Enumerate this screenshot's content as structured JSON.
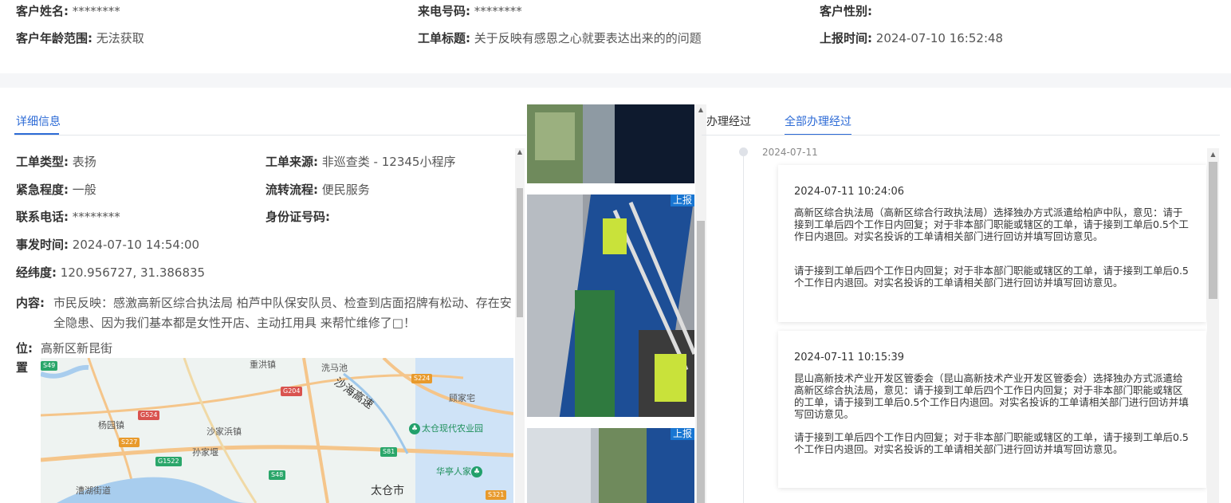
{
  "header": {
    "customer_name_label": "客户姓名:",
    "customer_name_value": "********",
    "caller_number_label": "来电号码:",
    "caller_number_value": "********",
    "gender_label": "客户性别:",
    "gender_value": "",
    "age_range_label": "客户年龄范围:",
    "age_range_value": "无法获取",
    "title_label": "工单标题:",
    "title_value": "关于反映有感恩之心就要表达出来的的问题",
    "report_time_label": "上报时间:",
    "report_time_value": "2024-07-10 16:52:48"
  },
  "left_tabs": {
    "detail": "详细信息"
  },
  "details": {
    "type_label": "工单类型:",
    "type_value": "表扬",
    "source_label": "工单来源:",
    "source_value": "非巡查类 - 12345小程序",
    "urgency_label": "紧急程度:",
    "urgency_value": "一般",
    "flow_label": "流转流程:",
    "flow_value": "便民服务",
    "phone_label": "联系电话:",
    "phone_value": "********",
    "id_label": "身份证号码:",
    "id_value": "",
    "event_time_label": "事发时间:",
    "event_time_value": "2024-07-10 14:54:00",
    "coords_label": "经纬度:",
    "coords_value": "120.956727, 31.386835",
    "content_label": "内容:",
    "content_value": "市民反映：感激高新区综合执法局 柏芦中队保安队员、检查到店面招牌有松动、存在安全隐患、因为我们基本都是女性开店、主动扛用具 来帮忙维修了□！",
    "location_label_1": "位:",
    "location_label_2": "置",
    "location_value": "高新区新昆街"
  },
  "map": {
    "labels": [
      "重洪镇",
      "洗马池",
      "沙海高速",
      "杨园镇",
      "沙家浜镇",
      "孙家堰",
      "漕湖街道",
      "太仓市",
      "顾家宅"
    ],
    "badges": [
      "G204",
      "S224",
      "G524",
      "S227",
      "G1522",
      "S81",
      "S48",
      "S321",
      "S49"
    ],
    "pois": [
      "太仓现代农业园",
      "华亭人家"
    ]
  },
  "photos": {
    "tag": "上报"
  },
  "right_tabs": {
    "tab1": "办理经过",
    "tab2": "全部办理经过"
  },
  "timeline": {
    "date": "2024-07-11",
    "entries": [
      {
        "time": "2024-07-11 10:24:06",
        "para1": "高新区综合执法局（高新区综合行政执法局）选择独办方式派遣给柏庐中队，意见：请于接到工单后四个工作日内回复；对于非本部门职能或辖区的工单，请于接到工单后0.5个工作日内退回。对实名投诉的工单请相关部门进行回访并填写回访意见。",
        "para2": "请于接到工单后四个工作日内回复；对于非本部门职能或辖区的工单，请于接到工单后0.5个工作日内退回。对实名投诉的工单请相关部门进行回访并填写回访意见。"
      },
      {
        "time": "2024-07-11 10:15:39",
        "para1": "昆山高新技术产业开发区管委会（昆山高新技术产业开发区管委会）选择独办方式派遣给高新区综合执法局，意见：请于接到工单后四个工作日内回复；对于非本部门职能或辖区的工单，请于接到工单后0.5个工作日内退回。对实名投诉的工单请相关部门进行回访并填写回访意见。",
        "para2": "请于接到工单后四个工作日内回复；对于非本部门职能或辖区的工单，请于接到工单后0.5个工作日内退回。对实名投诉的工单请相关部门进行回访并填写回访意见。"
      }
    ]
  },
  "colors": {
    "accent": "#2d6bd6",
    "photo_tag": "#1976d2",
    "poi": "#22a06b"
  }
}
